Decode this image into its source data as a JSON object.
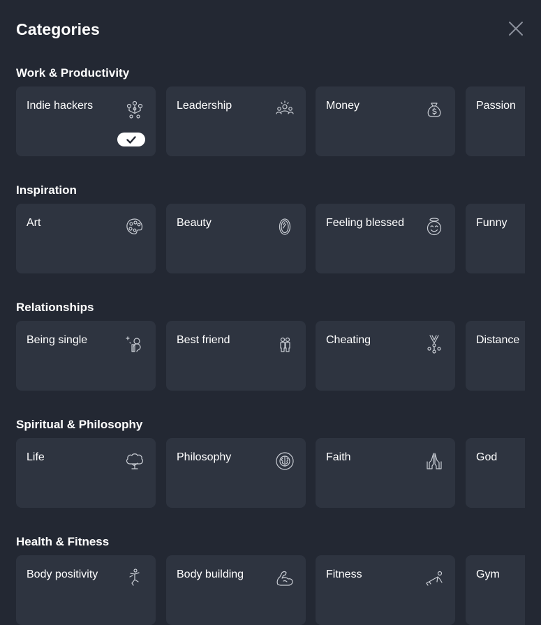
{
  "header": {
    "title": "Categories",
    "close_icon": "close-icon"
  },
  "sections": [
    {
      "title": "Work & Productivity",
      "cards": [
        {
          "label": "Indie hackers",
          "icon": "indie-hackers-icon",
          "selected": true
        },
        {
          "label": "Leadership",
          "icon": "leadership-icon"
        },
        {
          "label": "Money",
          "icon": "money-bag-icon"
        },
        {
          "label": "Passion",
          "icon": ""
        }
      ]
    },
    {
      "title": "Inspiration",
      "cards": [
        {
          "label": "Art",
          "icon": "palette-icon"
        },
        {
          "label": "Beauty",
          "icon": "mirror-icon"
        },
        {
          "label": "Feeling blessed",
          "icon": "halo-face-icon"
        },
        {
          "label": "Funny",
          "icon": ""
        }
      ]
    },
    {
      "title": "Relationships",
      "cards": [
        {
          "label": "Being single",
          "icon": "single-person-icon"
        },
        {
          "label": "Best friend",
          "icon": "friends-icon"
        },
        {
          "label": "Cheating",
          "icon": "cheating-icon"
        },
        {
          "label": "Distance",
          "icon": ""
        }
      ]
    },
    {
      "title": "Spiritual & Philosophy",
      "cards": [
        {
          "label": "Life",
          "icon": "tree-icon"
        },
        {
          "label": "Philosophy",
          "icon": "brain-circle-icon"
        },
        {
          "label": "Faith",
          "icon": "praying-hands-icon"
        },
        {
          "label": "God",
          "icon": ""
        }
      ]
    },
    {
      "title": "Health & Fitness",
      "cards": [
        {
          "label": "Body positivity",
          "icon": "dancer-icon"
        },
        {
          "label": "Body building",
          "icon": "biceps-icon"
        },
        {
          "label": "Fitness",
          "icon": "pushup-icon"
        },
        {
          "label": "Gym",
          "icon": ""
        }
      ]
    }
  ],
  "colors": {
    "background": "#232833",
    "card": "#2e3440",
    "icon": "#c9cdd4",
    "text": "#ffffff"
  }
}
